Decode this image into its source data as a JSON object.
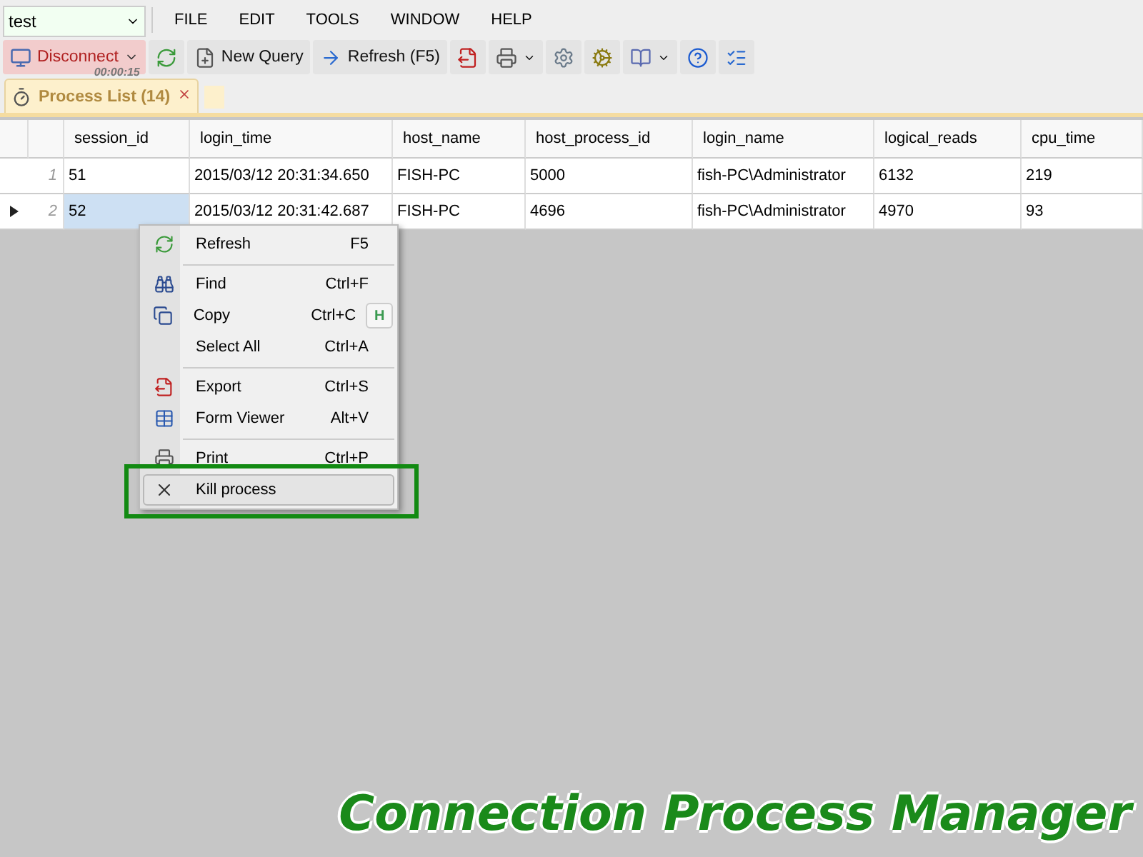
{
  "connection": {
    "value": "test"
  },
  "menu": [
    "FILE",
    "EDIT",
    "TOOLS",
    "WINDOW",
    "HELP"
  ],
  "toolbar": [
    {
      "kind": "disconnect",
      "label": "Disconnect",
      "timer": "00:00:15"
    },
    {
      "kind": "refresh"
    },
    {
      "kind": "new",
      "label": "New Query"
    },
    {
      "kind": "arrow",
      "label": "Refresh (F5)"
    },
    {
      "kind": "export"
    },
    {
      "kind": "print"
    },
    {
      "kind": "settings"
    },
    {
      "kind": "gears"
    },
    {
      "kind": "book"
    },
    {
      "kind": "help"
    },
    {
      "kind": "check"
    }
  ],
  "tabs": [
    {
      "label": "Process List (14)",
      "selected": true
    }
  ],
  "table": {
    "columns": [
      "session_id",
      "login_time",
      "host_name",
      "host_process_id",
      "login_name",
      "logical_reads",
      "cpu_time"
    ],
    "rows": [
      {
        "number": "1",
        "selected": false,
        "cells": [
          "51",
          "2015/03/12 20:31:34.650",
          "FISH-PC",
          "5000",
          "fish-PC\\Administrator",
          "6132",
          "219"
        ]
      },
      {
        "number": "2",
        "selected": true,
        "cells": [
          "52",
          "2015/03/12 20:31:42.687",
          "FISH-PC",
          "4696",
          "fish-PC\\Administrator",
          "4970",
          "93"
        ]
      }
    ]
  },
  "context_menu": {
    "groups": [
      [
        {
          "kind": "refresh",
          "label": "Refresh",
          "shortcut": "F5",
          "selected": false
        }
      ],
      [
        {
          "kind": "find",
          "label": "Find",
          "shortcut": "Ctrl+F",
          "selected": false
        },
        {
          "kind": "copy",
          "label": "Copy",
          "shortcut": "Ctrl+C",
          "badge": "H",
          "selected": false
        },
        {
          "kind": "plain",
          "label": "Select All",
          "shortcut": "Ctrl+A",
          "selected": false
        }
      ],
      [
        {
          "kind": "export",
          "label": "Export",
          "shortcut": "Ctrl+S",
          "selected": false
        },
        {
          "kind": "form",
          "label": "Form Viewer",
          "shortcut": "Alt+V",
          "selected": false
        }
      ],
      [
        {
          "kind": "print",
          "label": "Print",
          "shortcut": "Ctrl+P",
          "selected": false
        },
        {
          "kind": "kill",
          "label": "Kill process",
          "selected": true
        }
      ]
    ]
  },
  "caption": "Connection Process Manager"
}
